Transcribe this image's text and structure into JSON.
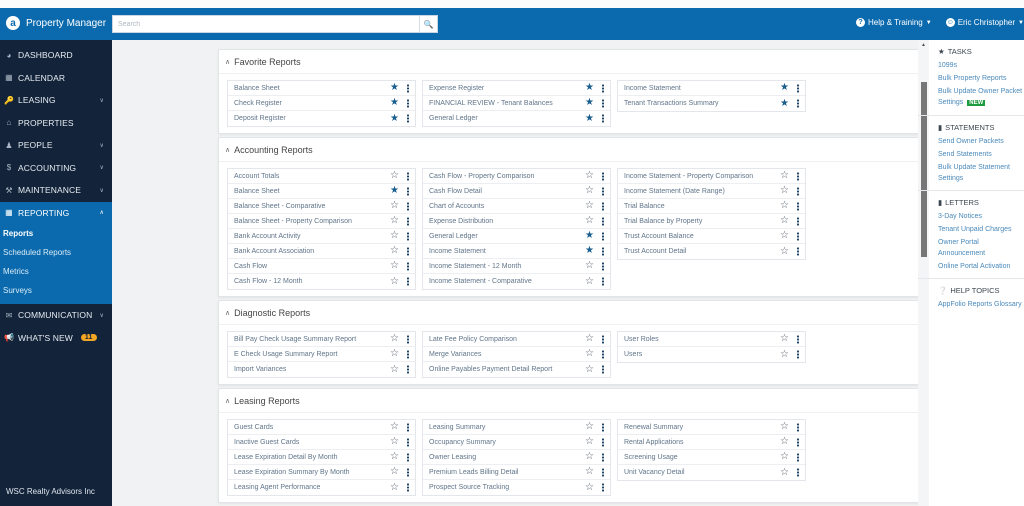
{
  "header": {
    "app_title": "Property Manager",
    "search_placeholder": "Search",
    "help_label": "Help & Training",
    "user_label": "Eric Christopher"
  },
  "sidebar": {
    "items": [
      {
        "label": "DASHBOARD",
        "icon": "dashboard-icon"
      },
      {
        "label": "CALENDAR",
        "icon": "calendar-icon"
      },
      {
        "label": "LEASING",
        "icon": "key-icon",
        "expandable": true
      },
      {
        "label": "PROPERTIES",
        "icon": "building-icon"
      },
      {
        "label": "PEOPLE",
        "icon": "people-icon",
        "expandable": true
      },
      {
        "label": "ACCOUNTING",
        "icon": "dollar-icon",
        "expandable": true
      },
      {
        "label": "MAINTENANCE",
        "icon": "wrench-icon",
        "expandable": true
      },
      {
        "label": "REPORTING",
        "icon": "table-icon",
        "expandable": true,
        "active": true
      }
    ],
    "reporting_sub": [
      "Reports",
      "Scheduled Reports",
      "Metrics",
      "Surveys"
    ],
    "communication_label": "COMMUNICATION",
    "whats_new_label": "WHAT'S NEW",
    "whats_new_count": "11",
    "company": "WSC Realty Advisors Inc"
  },
  "sections": [
    {
      "title": "Favorite Reports",
      "columns": [
        [
          {
            "name": "Balance Sheet",
            "fav": true
          },
          {
            "name": "Check Register",
            "fav": true
          },
          {
            "name": "Deposit Register",
            "fav": true
          }
        ],
        [
          {
            "name": "Expense Register",
            "fav": true
          },
          {
            "name": "FINANCIAL REVIEW - Tenant Balances",
            "fav": true
          },
          {
            "name": "General Ledger",
            "fav": true
          }
        ],
        [
          {
            "name": "Income Statement",
            "fav": true
          },
          {
            "name": "Tenant Transactions Summary",
            "fav": true
          }
        ]
      ]
    },
    {
      "title": "Accounting Reports",
      "columns": [
        [
          {
            "name": "Account Totals",
            "fav": false
          },
          {
            "name": "Balance Sheet",
            "fav": true
          },
          {
            "name": "Balance Sheet - Comparative",
            "fav": false
          },
          {
            "name": "Balance Sheet - Property Comparison",
            "fav": false
          },
          {
            "name": "Bank Account Activity",
            "fav": false
          },
          {
            "name": "Bank Account Association",
            "fav": false
          },
          {
            "name": "Cash Flow",
            "fav": false
          },
          {
            "name": "Cash Flow - 12 Month",
            "fav": false
          }
        ],
        [
          {
            "name": "Cash Flow - Property Comparison",
            "fav": false
          },
          {
            "name": "Cash Flow Detail",
            "fav": false
          },
          {
            "name": "Chart of Accounts",
            "fav": false
          },
          {
            "name": "Expense Distribution",
            "fav": false
          },
          {
            "name": "General Ledger",
            "fav": true
          },
          {
            "name": "Income Statement",
            "fav": true
          },
          {
            "name": "Income Statement - 12 Month",
            "fav": false
          },
          {
            "name": "Income Statement - Comparative",
            "fav": false
          }
        ],
        [
          {
            "name": "Income Statement - Property Comparison",
            "fav": false
          },
          {
            "name": "Income Statement (Date Range)",
            "fav": false
          },
          {
            "name": "Trial Balance",
            "fav": false
          },
          {
            "name": "Trial Balance by Property",
            "fav": false
          },
          {
            "name": "Trust Account Balance",
            "fav": false
          },
          {
            "name": "Trust Account Detail",
            "fav": false
          }
        ]
      ]
    },
    {
      "title": "Diagnostic Reports",
      "columns": [
        [
          {
            "name": "Bill Pay Check Usage Summary Report",
            "fav": false
          },
          {
            "name": "E Check Usage Summary Report",
            "fav": false
          },
          {
            "name": "Import Variances",
            "fav": false
          }
        ],
        [
          {
            "name": "Late Fee Policy Comparison",
            "fav": false
          },
          {
            "name": "Merge Variances",
            "fav": false
          },
          {
            "name": "Online Payables Payment Detail Report",
            "fav": false
          }
        ],
        [
          {
            "name": "User Roles",
            "fav": false
          },
          {
            "name": "Users",
            "fav": false
          }
        ]
      ]
    },
    {
      "title": "Leasing Reports",
      "columns": [
        [
          {
            "name": "Guest Cards",
            "fav": false
          },
          {
            "name": "Inactive Guest Cards",
            "fav": false
          },
          {
            "name": "Lease Expiration Detail By Month",
            "fav": false
          },
          {
            "name": "Lease Expiration Summary By Month",
            "fav": false
          },
          {
            "name": "Leasing Agent Performance",
            "fav": false
          }
        ],
        [
          {
            "name": "Leasing Summary",
            "fav": false
          },
          {
            "name": "Occupancy Summary",
            "fav": false
          },
          {
            "name": "Owner Leasing",
            "fav": false
          },
          {
            "name": "Premium Leads Billing Detail",
            "fav": false
          },
          {
            "name": "Prospect Source Tracking",
            "fav": false
          }
        ],
        [
          {
            "name": "Renewal Summary",
            "fav": false
          },
          {
            "name": "Rental Applications",
            "fav": false
          },
          {
            "name": "Screening Usage",
            "fav": false
          },
          {
            "name": "Unit Vacancy Detail",
            "fav": false
          }
        ]
      ]
    }
  ],
  "rightbar": {
    "tasks_title": "TASKS",
    "tasks": [
      "1099s",
      "Bulk Property Reports",
      "Bulk Update Owner Packet Settings"
    ],
    "new_badge": "NEW",
    "statements_title": "STATEMENTS",
    "statements": [
      "Send Owner Packets",
      "Send Statements",
      "Bulk Update Statement Settings"
    ],
    "letters_title": "LETTERS",
    "letters": [
      "3-Day Notices",
      "Tenant Unpaid Charges",
      "Owner Portal Announcement",
      "Online Portal Activation"
    ],
    "help_title": "HELP TOPICS",
    "help": [
      "AppFolio Reports Glossary"
    ]
  },
  "colors": {
    "brand": "#0b6aad",
    "sidebar": "#13233a",
    "star_on": "#1a5d8f",
    "badge": "#f5a623",
    "new_badge": "#1e9b3e"
  }
}
